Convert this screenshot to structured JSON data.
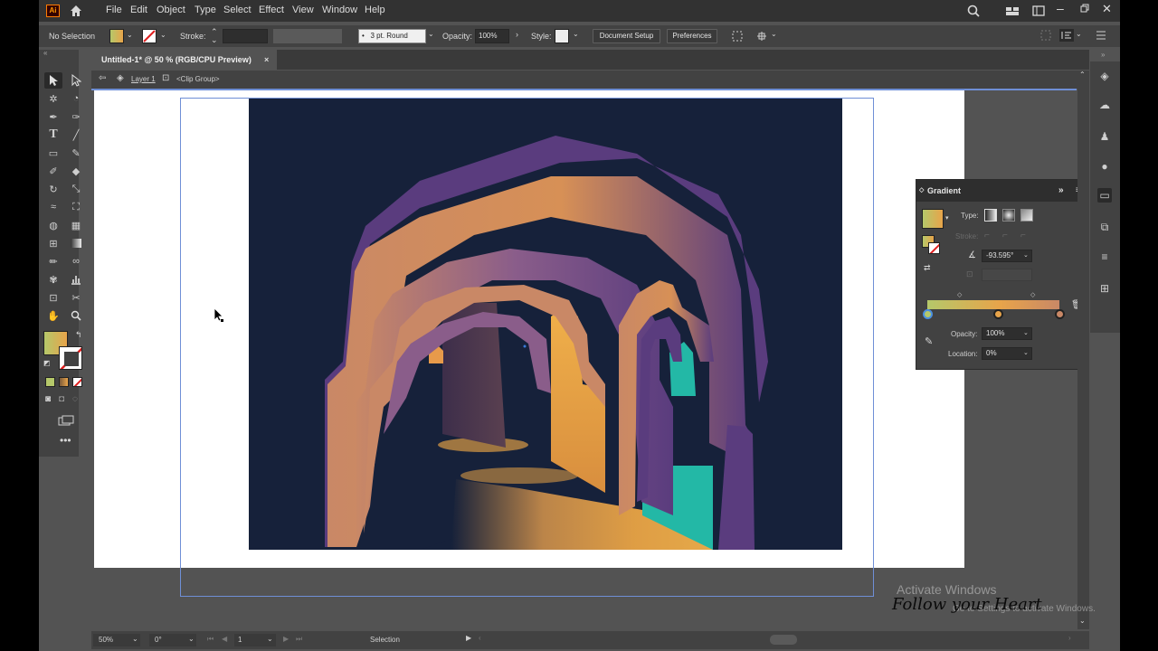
{
  "app": {
    "logo_text": "Ai"
  },
  "menu": [
    "File",
    "Edit",
    "Object",
    "Type",
    "Select",
    "Effect",
    "View",
    "Window",
    "Help"
  ],
  "control_bar": {
    "selection_status": "No Selection",
    "stroke_label": "Stroke:",
    "brush_value": "3 pt. Round",
    "opacity_label": "Opacity:",
    "opacity_value": "100%",
    "style_label": "Style:",
    "document_setup": "Document Setup",
    "preferences": "Preferences"
  },
  "document_tab": {
    "title": "Untitled-1* @ 50 % (RGB/CPU Preview)",
    "close": "×"
  },
  "breadcrumb": {
    "layer": "Layer 1",
    "group": "<Clip Group>"
  },
  "gradient_panel": {
    "title": "Gradient",
    "type_label": "Type:",
    "stroke_label": "Stroke:",
    "angle_value": "-93.595°",
    "opacity_label": "Opacity:",
    "opacity_value": "100%",
    "location_label": "Location:",
    "location_value": "0%"
  },
  "status_bar": {
    "zoom": "50%",
    "rotation": "0°",
    "artboard_number": "1",
    "tool_name": "Selection"
  },
  "overlay": {
    "activate_windows": "Activate Windows",
    "activate_sub": "Go to Settings to activate Windows.",
    "watermark": "Follow your Heart"
  },
  "colors": {
    "background_navy": "#16213a",
    "orange": "#e79a4a",
    "peach": "#c98866",
    "purple": "#5a3c7e",
    "teal": "#23b8a6",
    "gradient_start": "#b5c86a",
    "gradient_mid": "#e8a44a",
    "gradient_end": "#c98866"
  }
}
